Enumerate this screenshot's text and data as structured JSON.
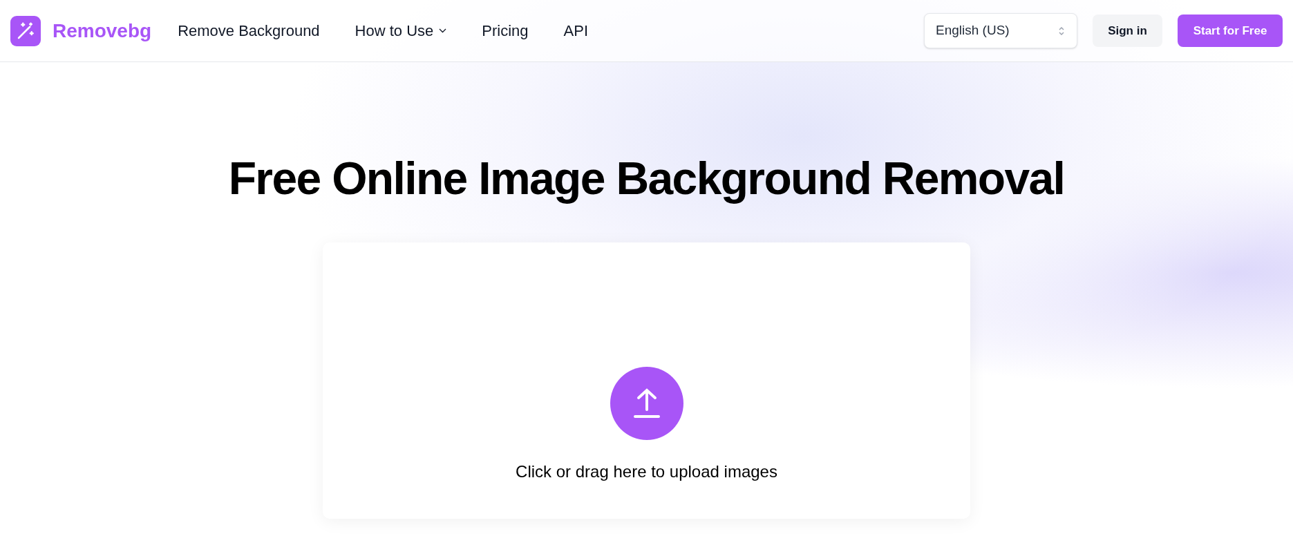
{
  "header": {
    "logo": "Removebg",
    "nav": [
      {
        "label": "Remove Background",
        "kind": "link"
      },
      {
        "label": "How to Use",
        "kind": "dropdown"
      },
      {
        "label": "Pricing",
        "kind": "link"
      },
      {
        "label": "API",
        "kind": "link"
      }
    ],
    "language": "English (US)",
    "sign_in": "Sign in",
    "start": "Start for Free"
  },
  "hero": {
    "title": "Free Online Image Background Removal",
    "upload_text": "Click or drag here to upload images"
  }
}
